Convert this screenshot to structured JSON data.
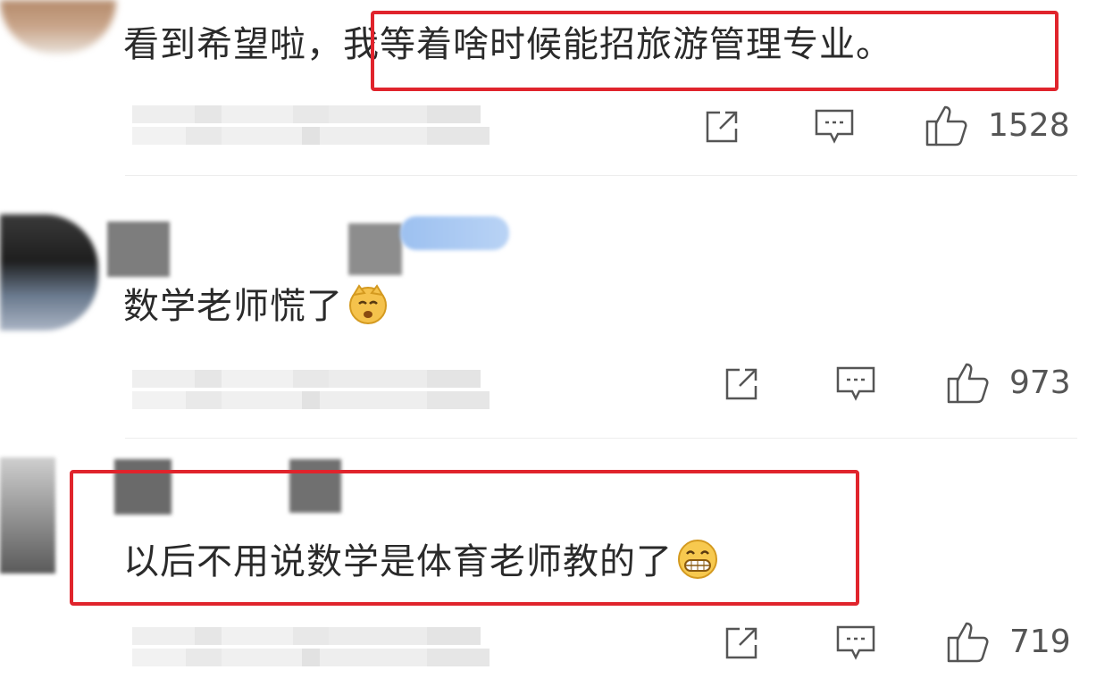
{
  "comments": [
    {
      "text_plain": "看到希望啦，",
      "text_highlight": "我等着啥时候能招旅游管理专业。",
      "likes": "1528",
      "icons": [
        "share-icon",
        "comment-icon",
        "like-icon"
      ]
    },
    {
      "text_plain": "数学老师慌了",
      "emoji": "sad-cat-emoji",
      "likes": "973",
      "icons": [
        "share-icon",
        "comment-icon",
        "like-icon"
      ]
    },
    {
      "text_highlight": "以后不用说数学是体育老师教的了",
      "emoji": "grin-emoji",
      "likes": "719",
      "icons": [
        "share-icon",
        "comment-icon",
        "like-icon"
      ]
    }
  ],
  "colors": {
    "highlight_border": "#e0242c",
    "text": "#2a2a2a",
    "icon": "#555555"
  }
}
